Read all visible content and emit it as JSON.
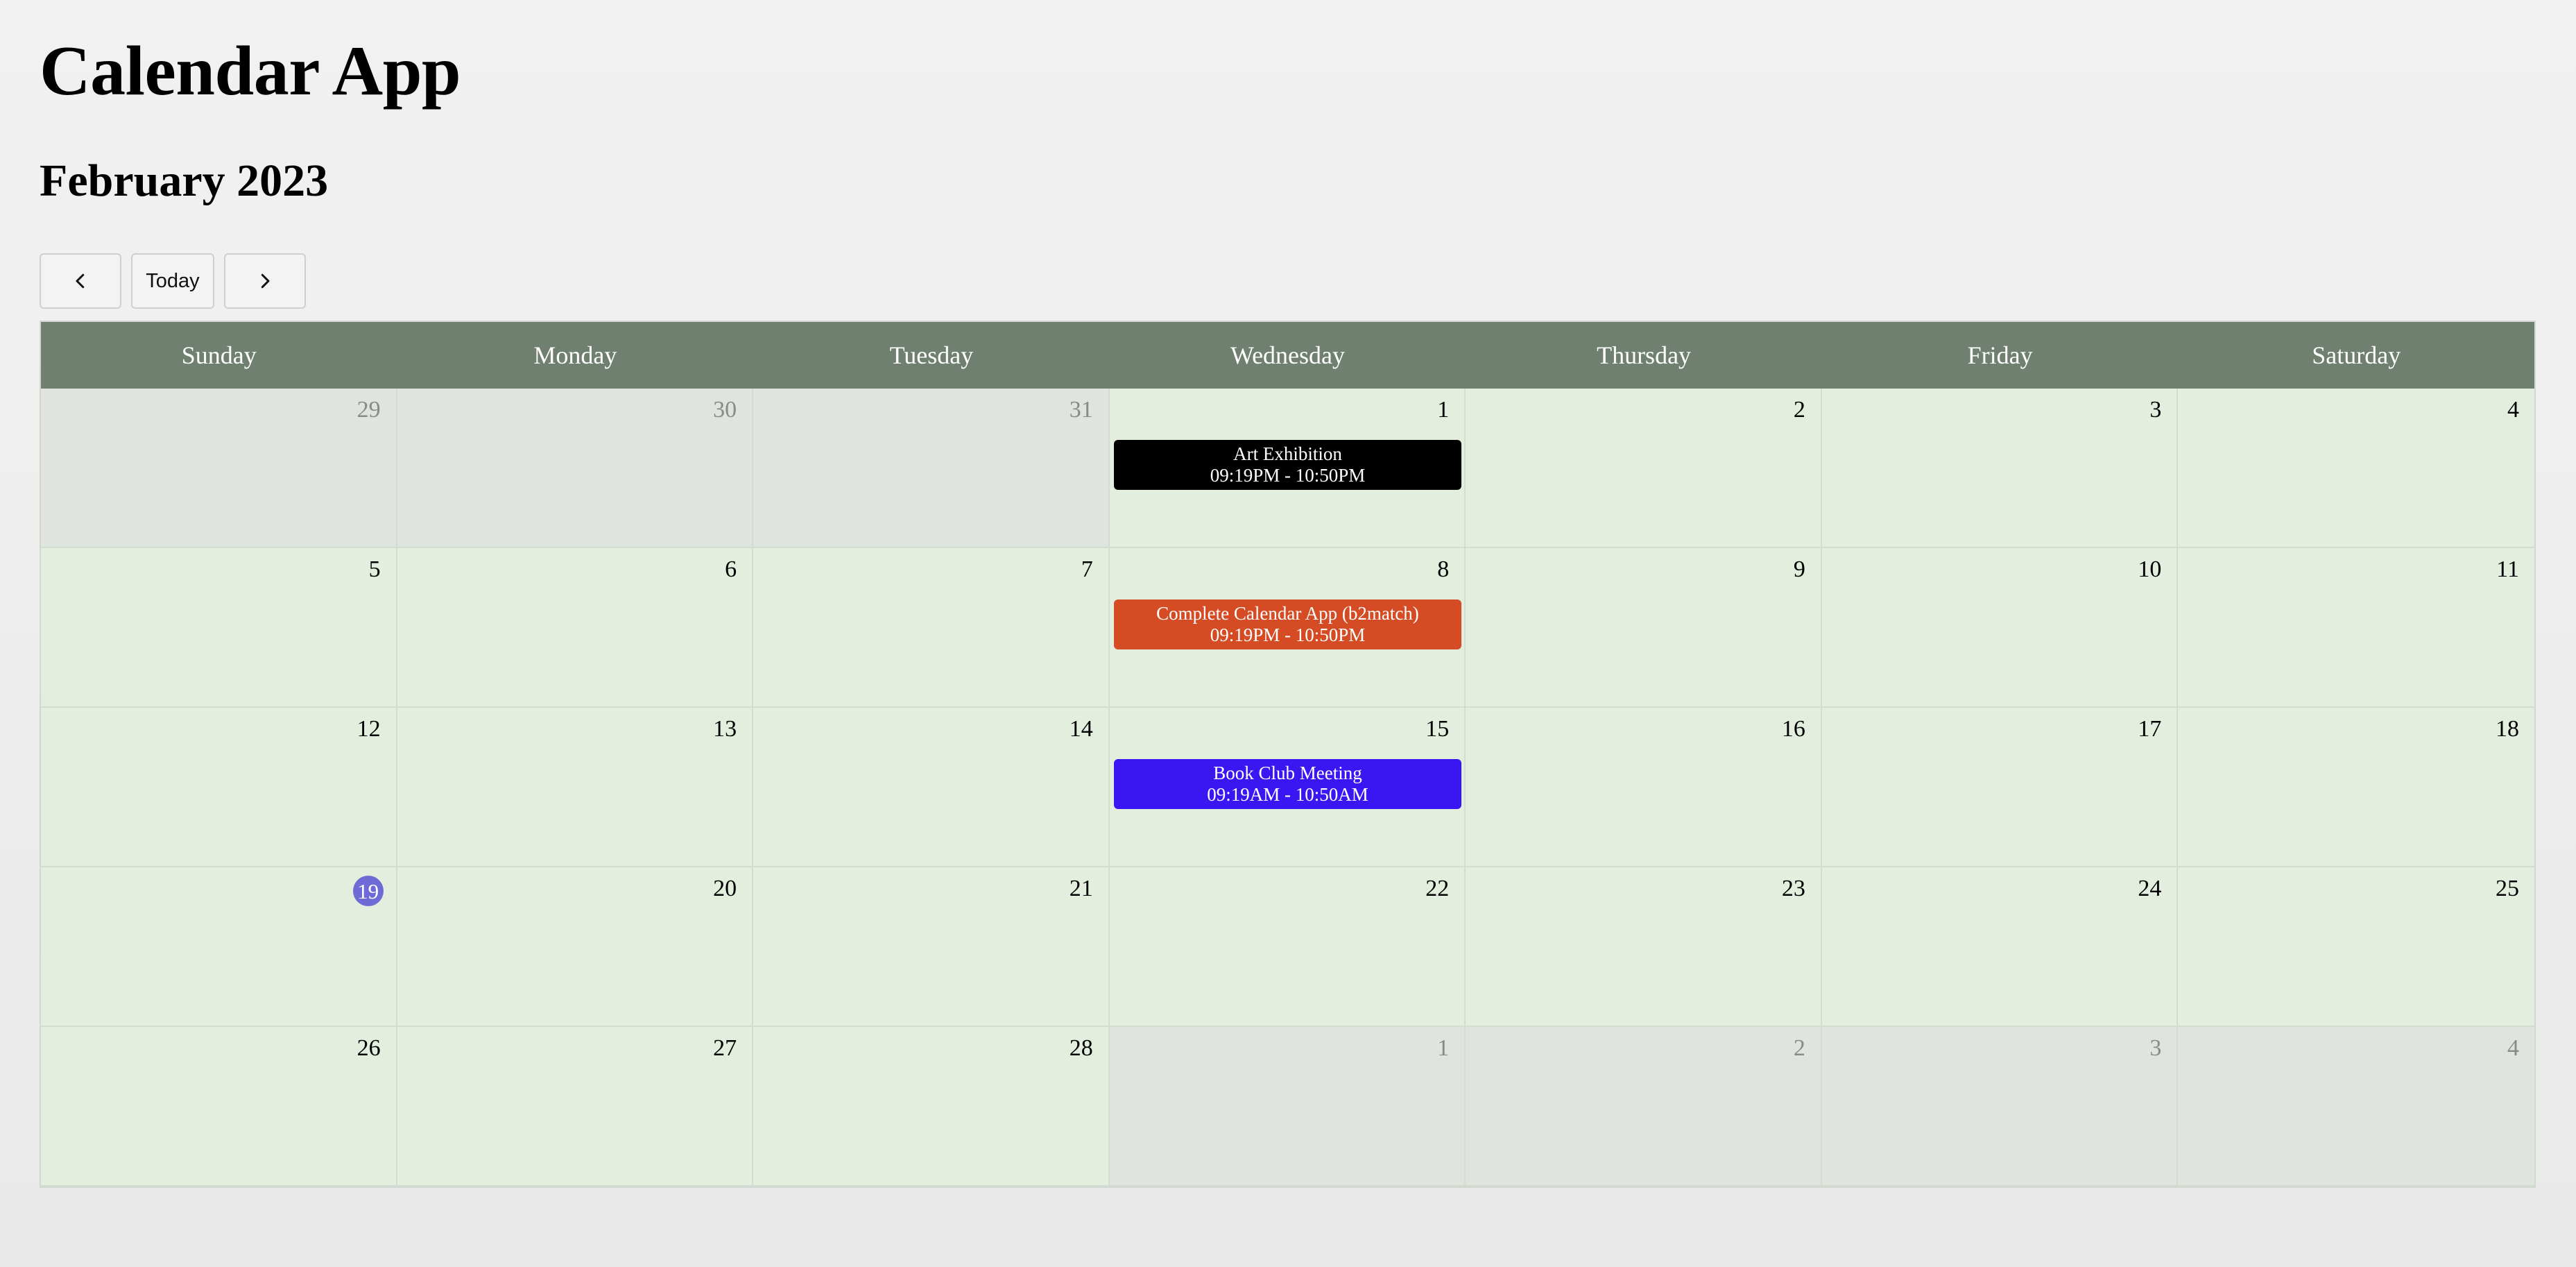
{
  "app": {
    "title": "Calendar App"
  },
  "month": {
    "title": "February 2023"
  },
  "nav": {
    "prev_icon": "chevron-left-icon",
    "today_label": "Today",
    "next_icon": "chevron-right-icon"
  },
  "weekdays": [
    "Sunday",
    "Monday",
    "Tuesday",
    "Wednesday",
    "Thursday",
    "Friday",
    "Saturday"
  ],
  "days": [
    {
      "num": "29",
      "other_month": true
    },
    {
      "num": "30",
      "other_month": true
    },
    {
      "num": "31",
      "other_month": true
    },
    {
      "num": "1",
      "event": {
        "title": "Art Exhibition",
        "time": "09:19PM - 10:50PM",
        "color": "#000000"
      }
    },
    {
      "num": "2"
    },
    {
      "num": "3"
    },
    {
      "num": "4"
    },
    {
      "num": "5"
    },
    {
      "num": "6"
    },
    {
      "num": "7"
    },
    {
      "num": "8",
      "event": {
        "title": "Complete Calendar App (b2match)",
        "time": "09:19PM - 10:50PM",
        "color": "#d44b24"
      }
    },
    {
      "num": "9"
    },
    {
      "num": "10"
    },
    {
      "num": "11"
    },
    {
      "num": "12"
    },
    {
      "num": "13"
    },
    {
      "num": "14"
    },
    {
      "num": "15",
      "event": {
        "title": "Book Club Meeting",
        "time": "09:19AM - 10:50AM",
        "color": "#3a17f2"
      }
    },
    {
      "num": "16"
    },
    {
      "num": "17"
    },
    {
      "num": "18"
    },
    {
      "num": "19",
      "today": true
    },
    {
      "num": "20"
    },
    {
      "num": "21"
    },
    {
      "num": "22"
    },
    {
      "num": "23"
    },
    {
      "num": "24"
    },
    {
      "num": "25"
    },
    {
      "num": "26"
    },
    {
      "num": "27"
    },
    {
      "num": "28"
    },
    {
      "num": "1",
      "other_month": true
    },
    {
      "num": "2",
      "other_month": true
    },
    {
      "num": "3",
      "other_month": true
    },
    {
      "num": "4",
      "other_month": true
    }
  ],
  "colors": {
    "header_bg": "#708070",
    "day_bg": "#e3eedf",
    "other_month_bg": "#dfe4de",
    "today_badge": "#6f6bd6"
  }
}
